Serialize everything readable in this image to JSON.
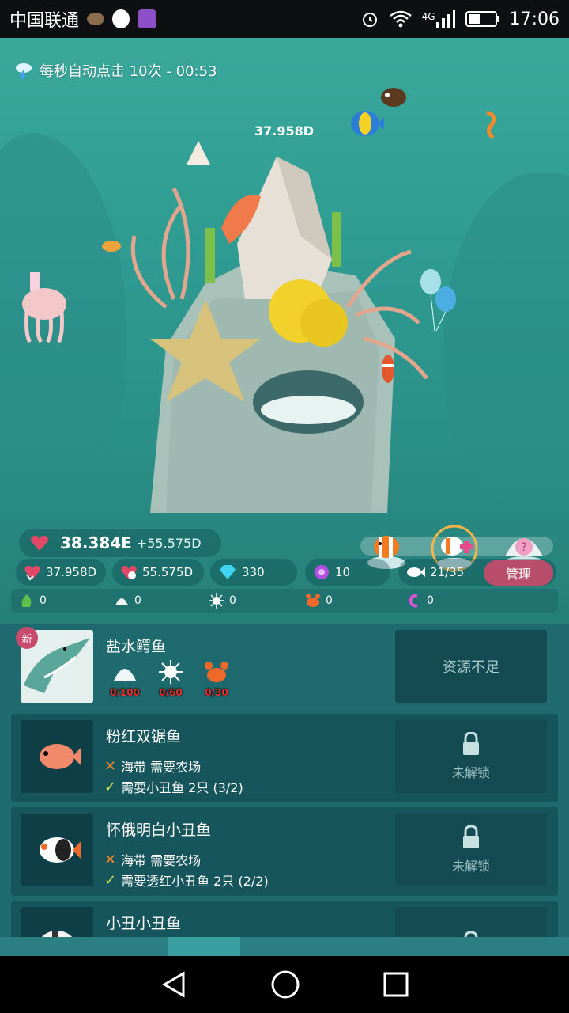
{
  "status_bar": {
    "carrier": "中国联通",
    "network": "4G",
    "time": "17:06"
  },
  "scene": {
    "boost_text": "每秒自动点击 10次 - 00:53",
    "floating_number": "37.958D"
  },
  "stats": {
    "hearts_total": "38.384E",
    "hearts_rate": "+55.575D",
    "tap_value": "37.958D",
    "per_second": "55.575D",
    "gems": "330",
    "pearls": "10",
    "fish_count": "21/35",
    "manage_label": "管理"
  },
  "materials": [
    {
      "icon": "seaweed-icon",
      "value": "0"
    },
    {
      "icon": "shell-icon",
      "value": "0"
    },
    {
      "icon": "urchin-icon",
      "value": "0"
    },
    {
      "icon": "crab-icon",
      "value": "0"
    },
    {
      "icon": "shrimp-icon",
      "value": "0"
    }
  ],
  "list": {
    "items": [
      {
        "name": "盐水鳄鱼",
        "badge": "新",
        "costs": [
          "0/100",
          "0/60",
          "0/30"
        ],
        "action": "资源不足"
      },
      {
        "name": "粉红双锯鱼",
        "req1": "海带 需要农场",
        "req2": "需要小丑鱼 2只 (3/2)",
        "action": "未解锁"
      },
      {
        "name": "怀俄明白小丑鱼",
        "req1": "海带 需要农场",
        "req2": "需要透红小丑鱼 2只 (2/2)",
        "action": "未解锁"
      },
      {
        "name": "小丑小丑鱼"
      }
    ]
  },
  "colors": {
    "scene_top": "#3aa89b",
    "list_bg": "#1e6a6e",
    "manage_btn": "#b84e6c",
    "cost_red": "#e23030"
  }
}
